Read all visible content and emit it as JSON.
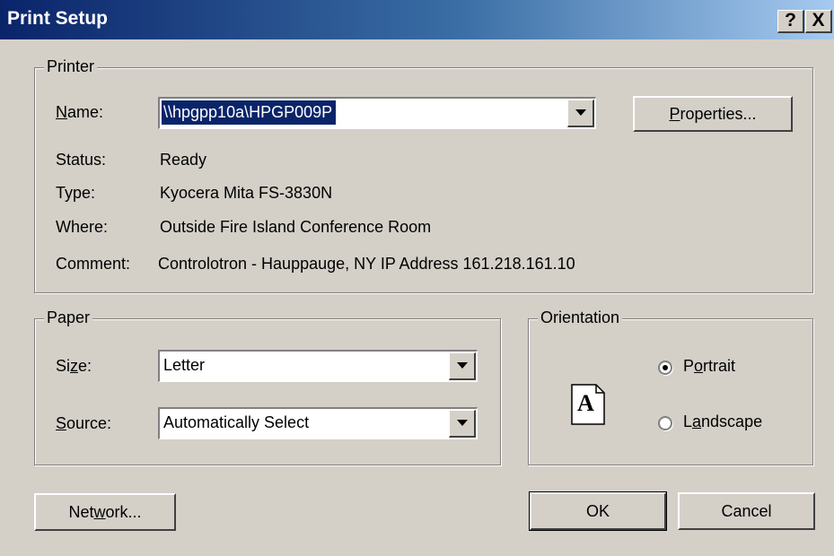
{
  "window": {
    "title": "Print Setup",
    "help_button": "?",
    "close_button": "X"
  },
  "printer": {
    "group_label": "Printer",
    "name_label": "Name:",
    "name_value": "\\\\hpgpp10a\\HPGP009P",
    "properties_button": "Properties...",
    "status_label": "Status:",
    "status_value": "Ready",
    "type_label": "Type:",
    "type_value": "Kyocera Mita FS-3830N",
    "where_label": "Where:",
    "where_value": "Outside Fire Island Conference Room",
    "comment_label": "Comment:",
    "comment_value": "Controlotron - Hauppauge, NY IP Address 161.218.161.10"
  },
  "paper": {
    "group_label": "Paper",
    "size_label": "Size:",
    "size_value": "Letter",
    "source_label": "Source:",
    "source_value": "Automatically Select"
  },
  "orientation": {
    "group_label": "Orientation",
    "page_icon_letter": "A",
    "portrait_label": "Portrait",
    "portrait_selected": true,
    "landscape_label": "Landscape",
    "landscape_selected": false
  },
  "buttons": {
    "network": "Network...",
    "ok": "OK",
    "cancel": "Cancel"
  }
}
